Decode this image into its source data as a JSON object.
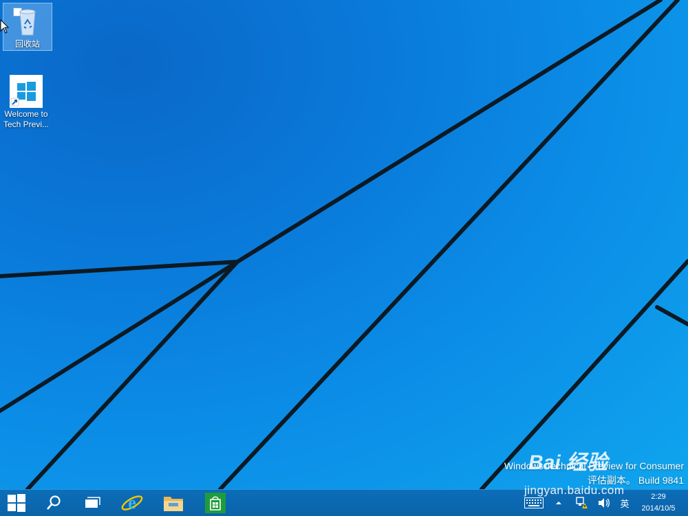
{
  "desktop": {
    "icons": [
      {
        "label": "回收站",
        "icon": "recycle-bin-icon",
        "selected": true
      },
      {
        "label_line1": "Welcome to",
        "label_line2": "Tech Previ...",
        "icon": "windows-logo-shortcut-icon"
      }
    ]
  },
  "watermark": {
    "line1": "Windows Technical Preview for Consumer",
    "line2": "评估副本。 Build 9841"
  },
  "overlay": {
    "brand": "Bai 经验",
    "url": "jingyan.baidu.com"
  },
  "taskbar": {
    "buttons": [
      {
        "name": "start-button",
        "icon": "windows-start-icon"
      },
      {
        "name": "search-button",
        "icon": "search-icon"
      },
      {
        "name": "task-view-button",
        "icon": "task-view-icon"
      },
      {
        "name": "internet-explorer-button",
        "icon": "ie-icon"
      },
      {
        "name": "file-explorer-button",
        "icon": "folder-icon"
      },
      {
        "name": "store-button",
        "icon": "store-icon"
      }
    ],
    "tray": {
      "ime_label": "英",
      "time": "2:29",
      "date": "2014/10/5"
    }
  },
  "colors": {
    "taskbar": "#0a63a9",
    "desktop_light": "#0fa5ee",
    "desktop_dark": "#0a68c8",
    "store_green": "#1e9c3b"
  }
}
